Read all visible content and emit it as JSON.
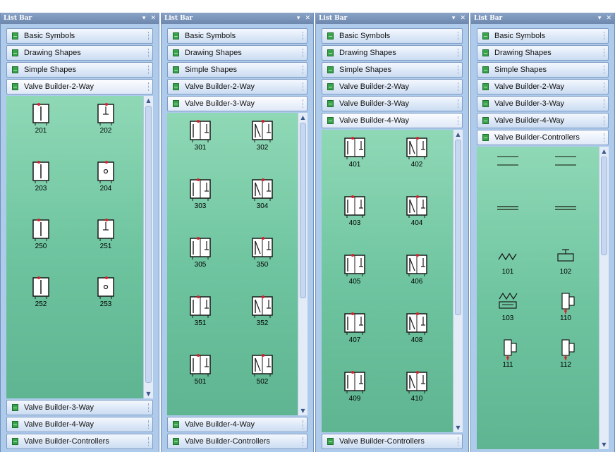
{
  "panels": [
    {
      "title": "List Bar",
      "headers_top": [
        "Basic Symbols",
        "Drawing Shapes",
        "Simple Shapes",
        "Valve Builder-2-Way"
      ],
      "headers_bottom": [
        "Valve Builder-3-Way",
        "Valve Builder-4-Way",
        "Valve Builder-Controllers"
      ],
      "items": [
        {
          "label": "201",
          "icon": "valve-2way-icon"
        },
        {
          "label": "202",
          "icon": "valve-2way-icon"
        },
        {
          "label": "203",
          "icon": "valve-2way-icon"
        },
        {
          "label": "204",
          "icon": "valve-2way-icon"
        },
        {
          "label": "250",
          "icon": "valve-2way-icon"
        },
        {
          "label": "251",
          "icon": "valve-2way-icon"
        },
        {
          "label": "252",
          "icon": "valve-2way-icon"
        },
        {
          "label": "253",
          "icon": "valve-2way-icon"
        }
      ]
    },
    {
      "title": "List Bar",
      "headers_top": [
        "Basic Symbols",
        "Drawing Shapes",
        "Simple Shapes",
        "Valve Builder-2-Way",
        "Valve Builder-3-Way"
      ],
      "headers_bottom": [
        "Valve Builder-4-Way",
        "Valve Builder-Controllers"
      ],
      "items": [
        {
          "label": "301",
          "icon": "valve-3way-icon"
        },
        {
          "label": "302",
          "icon": "valve-3way-icon"
        },
        {
          "label": "303",
          "icon": "valve-3way-icon"
        },
        {
          "label": "304",
          "icon": "valve-3way-icon"
        },
        {
          "label": "305",
          "icon": "valve-3way-icon"
        },
        {
          "label": "350",
          "icon": "valve-3way-icon"
        },
        {
          "label": "351",
          "icon": "valve-3way-icon"
        },
        {
          "label": "352",
          "icon": "valve-3way-icon"
        },
        {
          "label": "501",
          "icon": "valve-3way-icon"
        },
        {
          "label": "502",
          "icon": "valve-3way-icon"
        }
      ]
    },
    {
      "title": "List Bar",
      "headers_top": [
        "Basic Symbols",
        "Drawing Shapes",
        "Simple Shapes",
        "Valve Builder-2-Way",
        "Valve Builder-3-Way",
        "Valve Builder-4-Way"
      ],
      "headers_bottom": [
        "Valve Builder-Controllers"
      ],
      "items": [
        {
          "label": "401",
          "icon": "valve-4way-icon"
        },
        {
          "label": "402",
          "icon": "valve-4way-icon"
        },
        {
          "label": "403",
          "icon": "valve-4way-icon"
        },
        {
          "label": "404",
          "icon": "valve-4way-icon"
        },
        {
          "label": "405",
          "icon": "valve-4way-icon"
        },
        {
          "label": "406",
          "icon": "valve-4way-icon"
        },
        {
          "label": "407",
          "icon": "valve-4way-icon"
        },
        {
          "label": "408",
          "icon": "valve-4way-icon"
        },
        {
          "label": "409",
          "icon": "valve-4way-icon"
        },
        {
          "label": "410",
          "icon": "valve-4way-icon"
        }
      ]
    },
    {
      "title": "List Bar",
      "headers_top": [
        "Basic Symbols",
        "Drawing Shapes",
        "Simple Shapes",
        "Valve Builder-2-Way",
        "Valve Builder-3-Way",
        "Valve Builder-4-Way",
        "Valve Builder-Controllers"
      ],
      "headers_bottom": [],
      "items": [
        {
          "label": "",
          "icon": "line-pair-icon"
        },
        {
          "label": "",
          "icon": "line-pair-icon"
        },
        {
          "label": "",
          "icon": "double-line-icon"
        },
        {
          "label": "",
          "icon": "double-line-icon"
        },
        {
          "label": "101",
          "icon": "spring-icon"
        },
        {
          "label": "102",
          "icon": "pushbutton-icon"
        },
        {
          "label": "103",
          "icon": "spring-box-icon"
        },
        {
          "label": "110",
          "icon": "actuator-icon"
        },
        {
          "label": "111",
          "icon": "actuator-icon"
        },
        {
          "label": "112",
          "icon": "actuator-icon"
        }
      ]
    }
  ],
  "colors": {
    "accent_red": "#d8202a",
    "panel_bg": "#aecbec",
    "content_green": "#78cba6"
  }
}
